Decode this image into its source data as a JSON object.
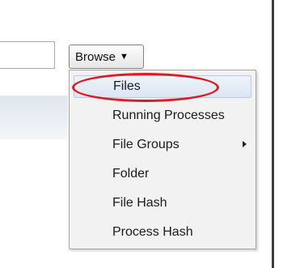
{
  "browse": {
    "label": "Browse",
    "arrow_icon": "chevron-down-icon"
  },
  "menu": {
    "items": [
      {
        "label": "Files",
        "selected": true
      },
      {
        "label": "Running Processes"
      },
      {
        "label": "File Groups",
        "has_submenu": true
      },
      {
        "label": "Folder"
      },
      {
        "label": "File Hash"
      },
      {
        "label": "Process Hash"
      }
    ]
  },
  "colors": {
    "annotation": "#e01a22",
    "selection": "#dbe6f3"
  }
}
